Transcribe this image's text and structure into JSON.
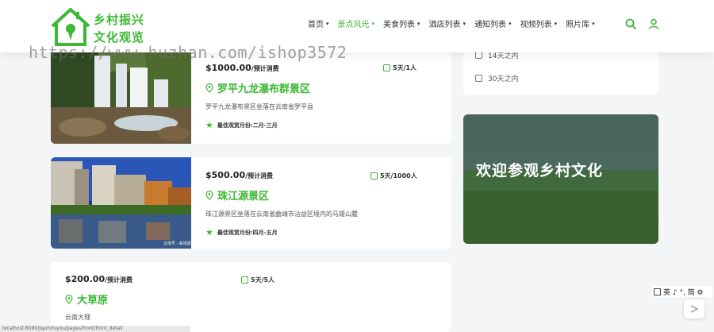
{
  "header": {
    "logo_line1": "乡村振兴",
    "logo_line2": "文化观览",
    "nav": [
      {
        "label": "首页",
        "has_caret": true
      },
      {
        "label": "景点风光",
        "has_caret": true,
        "active": true
      },
      {
        "label": "美食列表",
        "has_caret": true
      },
      {
        "label": "酒店列表",
        "has_caret": true
      },
      {
        "label": "通知列表",
        "has_caret": true
      },
      {
        "label": "视频列表",
        "has_caret": true
      },
      {
        "label": "照片库",
        "has_caret": true
      }
    ],
    "caret": "▾",
    "search_icon": "search-icon",
    "user_icon": "user-icon"
  },
  "watermark": "https://www.huzhan.com/ishop3572",
  "cards": [
    {
      "price": "$1000.00",
      "price_note": "/预计消费",
      "duration": "5天/1人",
      "title": "罗平九龙瀑布群景区",
      "desc": "罗平九龙瀑布景区坐落在云南省罗平县",
      "best": "最佳观赏月份:二月-三月"
    },
    {
      "price": "$500.00",
      "price_note": "/预计消费",
      "duration": "5天/1000人",
      "title": "珠江源景区",
      "desc": "珠江源景区坐落在云南省曲靖市沾益区境内的马雄山麓",
      "best": "最佳观赏月份:四月-五月",
      "img_caption": "云南号 · 曲靖旅"
    },
    {
      "price": "$200.00",
      "price_note": "/预计消费",
      "duration": "5天/5人",
      "title": "大草原",
      "desc": "云南大理"
    }
  ],
  "sidebar": {
    "filters": [
      "14天之内",
      "30天之内"
    ],
    "banner_text": "欢迎参观乡村文化"
  },
  "ime": "英 ♪ °, 简 ⚙",
  "status_url": "localhost:8080/jspm/lvyou/pages/front/front_detail"
}
